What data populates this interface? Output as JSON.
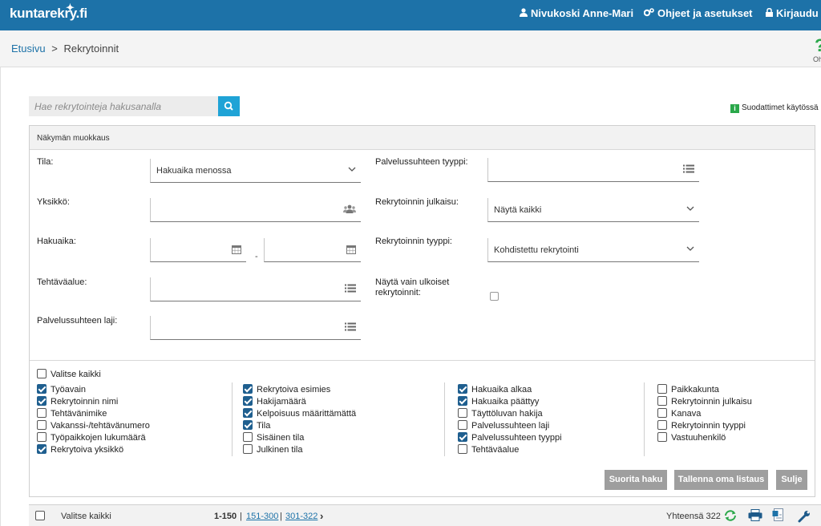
{
  "brand": {
    "logo_text": "kuntarekry.fi"
  },
  "topnav": {
    "user": "Nivukoski Anne-Mari",
    "help": "Ohjeet ja asetukset",
    "logout": "Kirjaudu ulos"
  },
  "breadcrumb": {
    "home": "Etusivu",
    "sep": ">",
    "current": "Rekrytoinnit"
  },
  "help_corner": {
    "mark": "?",
    "label": "Oh"
  },
  "search": {
    "placeholder": "Hae rekrytointeja hakusanalla"
  },
  "filters_active": {
    "badge": "i",
    "label": "Suodattimet käytössä"
  },
  "panel": {
    "title": "Näkymän muokkaus",
    "fields": {
      "tila": {
        "label": "Tila:",
        "value": "Hakuaika menossa"
      },
      "yksikko": {
        "label": "Yksikkö:"
      },
      "hakuaika": {
        "label": "Hakuaika:",
        "dash": "-"
      },
      "tehtavaalue": {
        "label": "Tehtäväalue:"
      },
      "palvelussuhteen_laji": {
        "label": "Palvelussuhteen laji:"
      },
      "palvelussuhteen_tyyppi": {
        "label": "Palvelussuhteen tyyppi:"
      },
      "julkaisu": {
        "label": "Rekrytoinnin julkaisu:",
        "value": "Näytä kaikki"
      },
      "rekry_tyyppi": {
        "label": "Rekrytoinnin tyyppi:",
        "value": "Kohdistettu rekrytointi"
      },
      "ulkoiset": {
        "label_line1": "Näytä vain ulkoiset",
        "label_line2": "rekrytoinnit:",
        "checked": false
      }
    },
    "select_all": {
      "label": "Valitse kaikki",
      "checked": false
    },
    "columns": [
      [
        {
          "label": "Työavain",
          "checked": true
        },
        {
          "label": "Rekrytoinnin nimi",
          "checked": true
        },
        {
          "label": "Tehtävänimike",
          "checked": false
        },
        {
          "label": "Vakanssi-/tehtävänumero",
          "checked": false
        },
        {
          "label": "Työpaikkojen lukumäärä",
          "checked": false
        },
        {
          "label": "Rekrytoiva yksikkö",
          "checked": true
        }
      ],
      [
        {
          "label": "Rekrytoiva esimies",
          "checked": true
        },
        {
          "label": "Hakijamäärä",
          "checked": true
        },
        {
          "label": "Kelpoisuus määrittämättä",
          "checked": true
        },
        {
          "label": "Tila",
          "checked": true
        },
        {
          "label": "Sisäinen tila",
          "checked": false
        },
        {
          "label": "Julkinen tila",
          "checked": false
        }
      ],
      [
        {
          "label": "Hakuaika alkaa",
          "checked": true
        },
        {
          "label": "Hakuaika päättyy",
          "checked": true
        },
        {
          "label": "Täyttöluvan hakija",
          "checked": false
        },
        {
          "label": "Palvelussuhteen laji",
          "checked": false
        },
        {
          "label": "Palvelussuhteen tyyppi",
          "checked": true
        },
        {
          "label": "Tehtäväalue",
          "checked": false
        }
      ],
      [
        {
          "label": "Paikkakunta",
          "checked": false
        },
        {
          "label": "Rekrytoinnin julkaisu",
          "checked": false
        },
        {
          "label": "Kanava",
          "checked": false
        },
        {
          "label": "Rekrytoinnin tyyppi",
          "checked": false
        },
        {
          "label": "Vastuuhenkilö",
          "checked": false
        }
      ]
    ],
    "buttons": {
      "search": "Suorita haku",
      "save": "Tallenna oma listaus",
      "close": "Sulje"
    }
  },
  "listbar": {
    "select_all": "Valitse kaikki",
    "page_current": "1-150",
    "page_2": "151-300",
    "page_3": "301-322",
    "next": "›",
    "total": "Yhteensä 322"
  },
  "colors": {
    "topbar": "#1d72a8",
    "accent": "#1fa3d6",
    "checked": "#1f5f8f",
    "button": "#9e9e9e",
    "badge": "#2aa84a"
  }
}
